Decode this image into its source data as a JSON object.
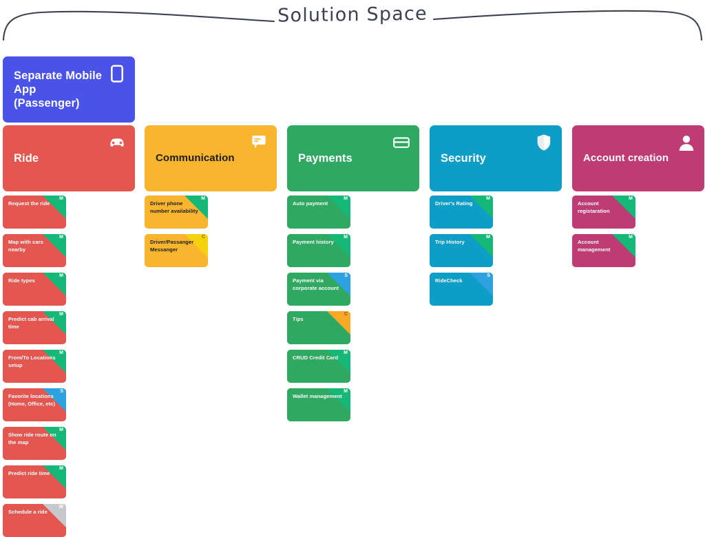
{
  "header": {
    "title": "Solution Space",
    "line_color": "#3c4250"
  },
  "legend_codes": {
    "M": {
      "label": "M",
      "bg": "#16b877",
      "fg": "#ffffff"
    },
    "S": {
      "label": "S",
      "bg": "#2ea2e0",
      "fg": "#ffffff"
    },
    "C": {
      "label": "C",
      "bg": "#f5d20c",
      "fg": "#8a6d00"
    },
    "C_orange": {
      "label": "C",
      "bg": "#f7a928",
      "fg": "#8a4f00"
    },
    "W": {
      "label": "W",
      "bg": "#c6c8cc",
      "fg": "#ffffff"
    }
  },
  "platform_card": {
    "title": "Separate Mobile App (Passenger)",
    "color": "#4a53e8",
    "text_tone": "light",
    "icon": "mobile-phone-icon"
  },
  "columns": [
    {
      "id": "ride",
      "title": "Ride",
      "color": "#e35750",
      "text_tone": "light",
      "icon": "car-icon",
      "stories": [
        {
          "label": "Request the ride",
          "badge": "M"
        },
        {
          "label": "Map with cars nearby",
          "badge": "M"
        },
        {
          "label": "Ride types",
          "badge": "M"
        },
        {
          "label": "Predict cab arrival time",
          "badge": "M"
        },
        {
          "label": "From/To Locations setup",
          "badge": "M"
        },
        {
          "label": "Favorite locations (Home, Office, etc)",
          "badge": "S"
        },
        {
          "label": "Show ride route on the map",
          "badge": "M"
        },
        {
          "label": "Predict ride time",
          "badge": "M"
        },
        {
          "label": "Schedule a ride",
          "badge": "W"
        }
      ]
    },
    {
      "id": "communication",
      "title": "Communication",
      "color": "#f9b52e",
      "text_tone": "dark",
      "icon": "chat-bubble-icon",
      "stories": [
        {
          "label": "Driver phone number availability",
          "badge": "M"
        },
        {
          "label": "Driver/Passanger Messanger",
          "badge": "C"
        }
      ]
    },
    {
      "id": "payments",
      "title": "Payments",
      "color": "#2fa862",
      "text_tone": "light",
      "icon": "credit-card-icon",
      "stories": [
        {
          "label": "Auto payment",
          "badge": "M"
        },
        {
          "label": "Payment history",
          "badge": "M"
        },
        {
          "label": "Payment via corporate account",
          "badge": "S"
        },
        {
          "label": "Tips",
          "badge": "C_orange"
        },
        {
          "label": "CRUD Credit Card",
          "badge": "M"
        },
        {
          "label": "Wallet management",
          "badge": "M"
        }
      ]
    },
    {
      "id": "security",
      "title": "Security",
      "color": "#0d9dc7",
      "text_tone": "light",
      "icon": "shield-icon",
      "stories": [
        {
          "label": "Driver's Rating",
          "badge": "M"
        },
        {
          "label": "Trip History",
          "badge": "M"
        },
        {
          "label": "RideCheck",
          "badge": "S"
        }
      ]
    },
    {
      "id": "account-creation",
      "title": "Account creation",
      "color": "#bf3b74",
      "text_tone": "light",
      "icon": "user-icon",
      "stories": [
        {
          "label": "Account registaration",
          "badge": "M"
        },
        {
          "label": "Account management",
          "badge": "M"
        }
      ]
    }
  ]
}
